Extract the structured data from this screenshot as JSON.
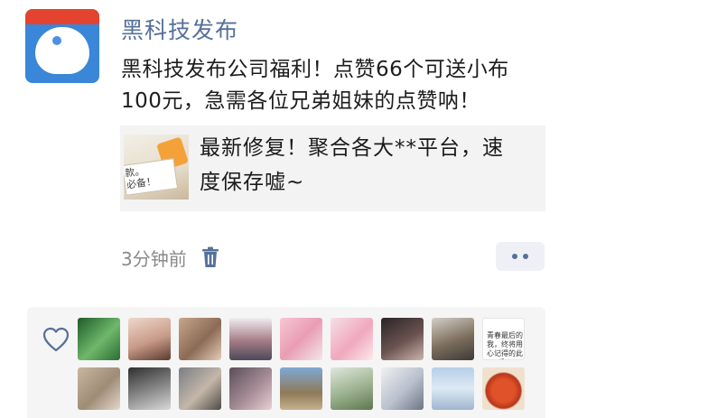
{
  "post": {
    "author": "黑科技发布",
    "text": "黑科技发布公司福利！点赞66个可送小布100元，急需各位兄弟姐妹的点赞呐！",
    "link_card": {
      "thumb_text": "款。\n必备！",
      "title": "最新修复！聚合各大**平台，速度保存嘘~"
    },
    "time": "3分钟前"
  },
  "icons": {
    "avatar": "doraemon-avatar-icon",
    "delete": "trash-icon",
    "more": "more-dots-icon",
    "like": "heart-outline-icon"
  },
  "colors": {
    "author_name": "#56709a",
    "time_text": "#8a8a8a",
    "card_bg": "#f3f3f3",
    "likes_bg": "#f5f5f5"
  },
  "likes": {
    "row1": [
      {
        "style": "linear-gradient(135deg,#1f5a2a,#6fb86a 55%,#2c6b33)"
      },
      {
        "style": "linear-gradient(160deg,#efd8cc,#c89a87 55%,#5a3a2e)"
      },
      {
        "style": "linear-gradient(135deg,#c7a68c,#8b6b54 55%,#e4cdb8)"
      },
      {
        "style": "linear-gradient(180deg,#f0eef0,#a47b85 55%,#4c4a5a)"
      },
      {
        "style": "linear-gradient(135deg,#f7c7d4,#e99db3 50%,#f3e6ea)"
      },
      {
        "style": "linear-gradient(135deg,#f6dfe7,#f0a8be 55%,#fce9ee)"
      },
      {
        "style": "linear-gradient(150deg,#2a2426,#6a5350 55%,#cdb4ad)"
      },
      {
        "style": "linear-gradient(160deg,#d3cfc7,#7c6d5c 55%,#3d3a38)"
      },
      {
        "style": "#ffffff",
        "caption": "青春最后的我，终将用心记得的此后。"
      }
    ],
    "row2": [
      {
        "style": "linear-gradient(135deg,#c9b6a0,#9f8c76 55%,#e4d9cc)"
      },
      {
        "style": "linear-gradient(160deg,#2f2f2f,#8b8b8b 55%,#d9d9d9)"
      },
      {
        "style": "linear-gradient(135deg,#7a7d84,#c4b7a9 55%,#4f4a46)"
      },
      {
        "style": "linear-gradient(135deg,#5a4e59,#a58c95 55%,#e8d0d6)"
      },
      {
        "style": "linear-gradient(180deg,#7fa8d4,#8f7a59 60%,#c6b28e)"
      },
      {
        "style": "linear-gradient(160deg,#dfe7dc,#9bb08d 55%,#5f7551)"
      },
      {
        "style": "linear-gradient(135deg,#eef0f2,#b9c0cc 55%,#6d7584)"
      },
      {
        "style": "linear-gradient(180deg,#b7cfe8,#dce9f4 50%,#9fb6cf)"
      },
      {
        "style": "radial-gradient(circle at 50% 55%,#e0532a 35%,#b8361b 55%,#f0e1cf 60%)"
      }
    ]
  }
}
